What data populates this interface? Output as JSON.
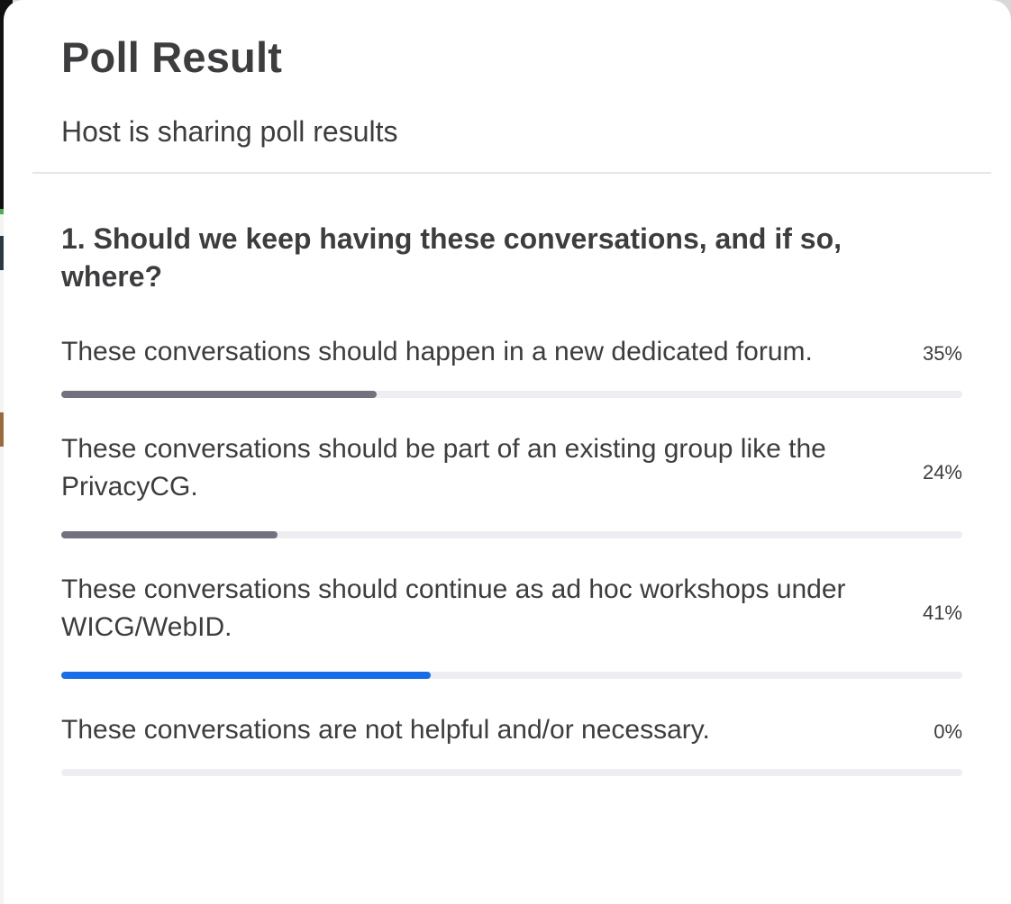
{
  "dialog": {
    "title": "Poll Result",
    "subtitle": "Host is sharing poll results"
  },
  "question": {
    "text": "1. Should we keep having these conversations, and if so, where?",
    "options": [
      {
        "text": "These conversations should happen in a new dedicated forum.",
        "percent_label": "35%",
        "percent": 35,
        "bar_color": "#727180"
      },
      {
        "text": "These conversations should be part of an existing group like the PrivacyCG.",
        "percent_label": "24%",
        "percent": 24,
        "bar_color": "#727180"
      },
      {
        "text": "These conversations should continue as ad hoc workshops under WICG/WebID.",
        "percent_label": "41%",
        "percent": 41,
        "bar_color": "#1a6de8"
      },
      {
        "text": "These conversations are not helpful and/or necessary.",
        "percent_label": "0%",
        "percent": 0,
        "bar_color": "#727180"
      }
    ]
  },
  "colors": {
    "text": "#3d3d3f",
    "track": "#eeeef2",
    "bar_default": "#727180",
    "bar_leading": "#1a6de8"
  }
}
